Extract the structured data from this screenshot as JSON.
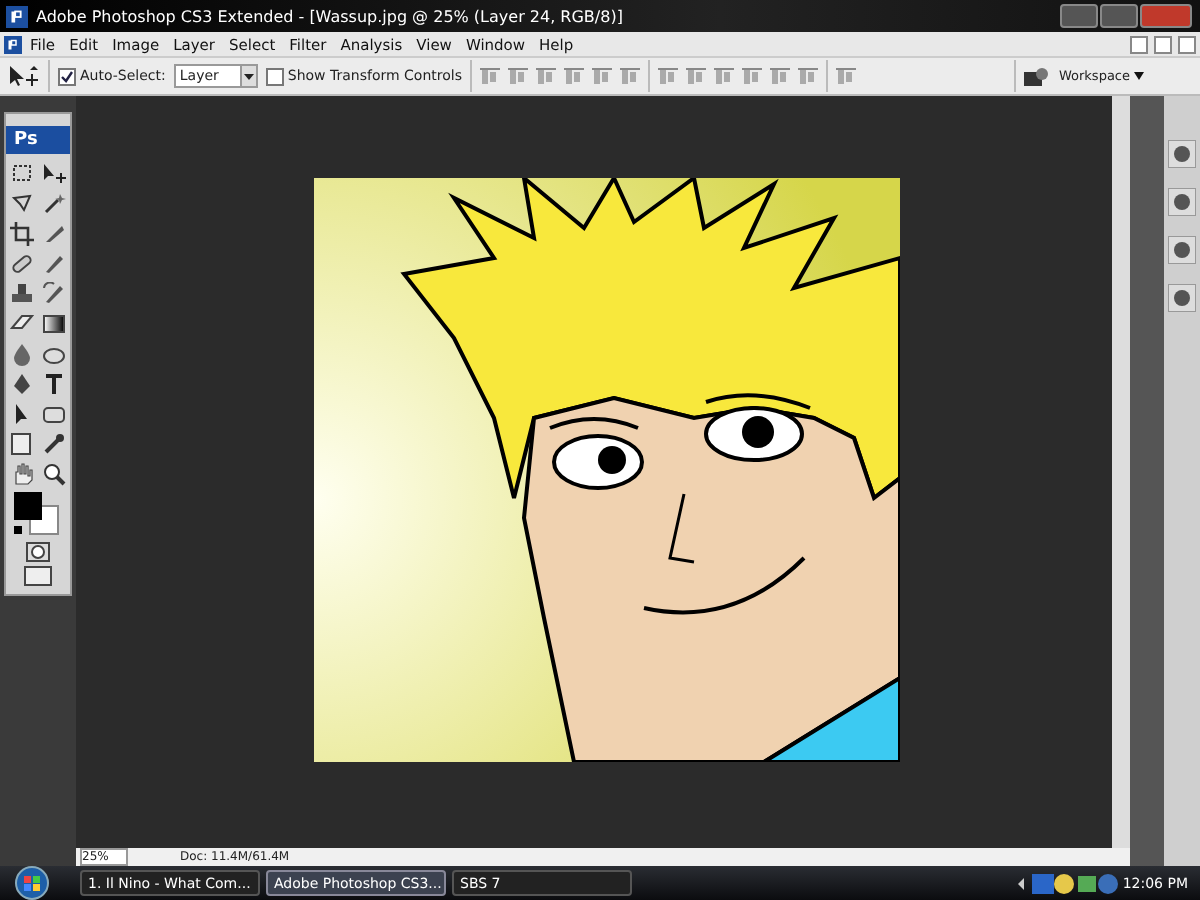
{
  "window": {
    "title": "Adobe Photoshop CS3 Extended - [Wassup.jpg @ 25% (Layer 24, RGB/8)]"
  },
  "menu": [
    "File",
    "Edit",
    "Image",
    "Layer",
    "Select",
    "Filter",
    "Analysis",
    "View",
    "Window",
    "Help"
  ],
  "options_bar": {
    "auto_select": {
      "label": "Auto-Select:",
      "checked": true
    },
    "auto_select_target": "Layer",
    "show_transform": {
      "label": "Show Transform Controls",
      "checked": false
    },
    "workspace": "Workspace"
  },
  "toolbox": {
    "logo": "Ps"
  },
  "status_bar": {
    "zoom": "25%",
    "doc_info": "Doc: 11.4M/61.4M"
  },
  "taskbar": {
    "buttons": [
      {
        "label": "1. Il Nino - What Com...",
        "selected": false
      },
      {
        "label": "Adobe Photoshop CS3...",
        "selected": true
      },
      {
        "label": "SBS 7",
        "selected": false
      }
    ],
    "clock": "12:06 PM"
  }
}
